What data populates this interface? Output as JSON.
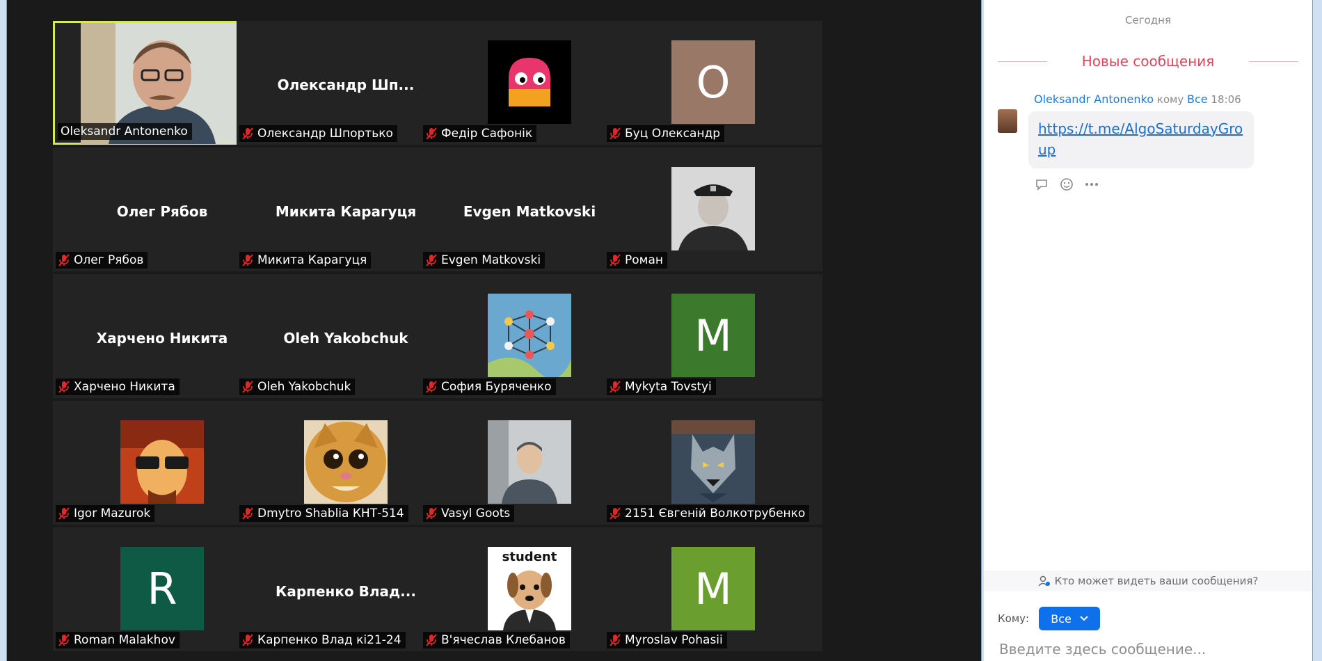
{
  "gallery": {
    "tiles": [
      {
        "name": "Oleksandr Antonenko",
        "display": "",
        "type": "video",
        "active": true,
        "color": "#8fa0a8"
      },
      {
        "name": "Олександр Шпортько",
        "display": "Олександр  Шп...",
        "type": "name",
        "active": false,
        "color": ""
      },
      {
        "name": "Федір Сафонік",
        "display": "",
        "type": "image",
        "image": "pacman-ghost-avatar",
        "active": false,
        "color": "#000000"
      },
      {
        "name": "Буц Олександр",
        "display": "O",
        "type": "letter",
        "active": false,
        "color": "#9a7868"
      },
      {
        "name": "Олег Рябов",
        "display": "Олег Рябов",
        "type": "name",
        "active": false,
        "color": ""
      },
      {
        "name": "Микита Карагуця",
        "display": "Микита Карагуця",
        "type": "name",
        "active": false,
        "color": ""
      },
      {
        "name": "Evgen Matkovski",
        "display": "Evgen Matkovski",
        "type": "name",
        "active": false,
        "color": ""
      },
      {
        "name": "Роман",
        "display": "",
        "type": "image",
        "image": "police-officer-photo",
        "active": false,
        "color": "#cfcfcf"
      },
      {
        "name": "Харчено Никита",
        "display": "Харчено Никита",
        "type": "name",
        "active": false,
        "color": ""
      },
      {
        "name": "Oleh Yakobchuk",
        "display": "Oleh Yakobchuk",
        "type": "name",
        "active": false,
        "color": ""
      },
      {
        "name": "София Буряченко",
        "display": "",
        "type": "image",
        "image": "graph-art-avatar",
        "active": false,
        "color": "#5a9fc8"
      },
      {
        "name": "Mykyta Tovstyi",
        "display": "M",
        "type": "letter",
        "active": false,
        "color": "#3b7a2c"
      },
      {
        "name": "Igor Mazurok",
        "display": "",
        "type": "image",
        "image": "sunglasses-portrait",
        "active": false,
        "color": "#c0401a"
      },
      {
        "name": "Dmytro Shablia КНТ-514",
        "display": "",
        "type": "image",
        "image": "cat-avatar",
        "active": false,
        "color": "#d59a3a"
      },
      {
        "name": "Vasyl Goots",
        "display": "",
        "type": "image",
        "image": "man-photo",
        "active": false,
        "color": "#8a8a8a"
      },
      {
        "name": "2151 Євгеній Волкотрубенко",
        "display": "",
        "type": "image",
        "image": "wolf-avatar",
        "active": false,
        "color": "#4a5a6a"
      },
      {
        "name": "Roman Malakhov",
        "display": "R",
        "type": "letter",
        "active": false,
        "color": "#0f5a44"
      },
      {
        "name": "Карпенко Влад кі21-24",
        "display": "Карпенко  Влад...",
        "type": "name",
        "active": false,
        "color": ""
      },
      {
        "name": "В'ячеслав Клебанов",
        "display": "student",
        "type": "image",
        "image": "student-dog-avatar",
        "active": false,
        "color": "#ffffff"
      },
      {
        "name": "Myroslav Pohasii",
        "display": "M",
        "type": "letter",
        "active": false,
        "color": "#6a9e2f"
      }
    ]
  },
  "chat": {
    "date_separator": "Сегодня",
    "new_messages_label": "Новые сообщения",
    "message": {
      "sender": "Oleksandr Antonenko",
      "to_prefix": "кому",
      "recipient": "Все",
      "time": "18:06",
      "text": "https://t.me/AlgoSaturdayGroup"
    },
    "actions": [
      "reply-icon",
      "emoji-icon",
      "more-icon"
    ],
    "who_can_see": "Кто может видеть ваши сообщения?",
    "to_label": "Кому:",
    "to_value": "Все",
    "input_placeholder": "Введите здесь сообщение..."
  },
  "colors": {
    "active_speaker_border": "#d6e85a",
    "muted_mic": "#e02828",
    "new_messages": "#e0465a",
    "link": "#1d6fcf",
    "to_button": "#0e71eb"
  }
}
